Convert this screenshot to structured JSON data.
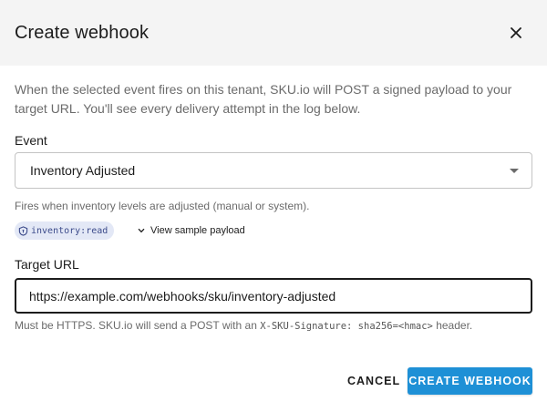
{
  "dialog": {
    "title": "Create webhook",
    "close_icon": "close-icon",
    "intro": "When the selected event fires on this tenant, SKU.io will POST a signed payload to your target URL. You'll see every delivery attempt in the log below."
  },
  "event": {
    "label": "Event",
    "selected": "Inventory Adjusted",
    "dropdown_icon": "caret-down-icon",
    "helper": "Fires when inventory levels are adjusted (manual or system).",
    "scope_icon": "shield-icon",
    "scope": "inventory:read",
    "sample_icon": "chevron-down-icon",
    "sample_link": "View sample payload"
  },
  "target_url": {
    "label": "Target URL",
    "value": "https://example.com/webhooks/sku/inventory-adjusted",
    "helper_prefix": "Must be HTTPS. SKU.io will send a POST with an ",
    "helper_code": "X-SKU-Signature: sha256=<hmac>",
    "helper_suffix": " header."
  },
  "actions": {
    "cancel": "CANCEL",
    "create": "CREATE WEBHOOK"
  },
  "colors": {
    "header_bg": "#f4f4f4",
    "primary": "#1e90d6",
    "badge_bg": "#e3e8f6",
    "badge_text": "#3b4a8a"
  }
}
